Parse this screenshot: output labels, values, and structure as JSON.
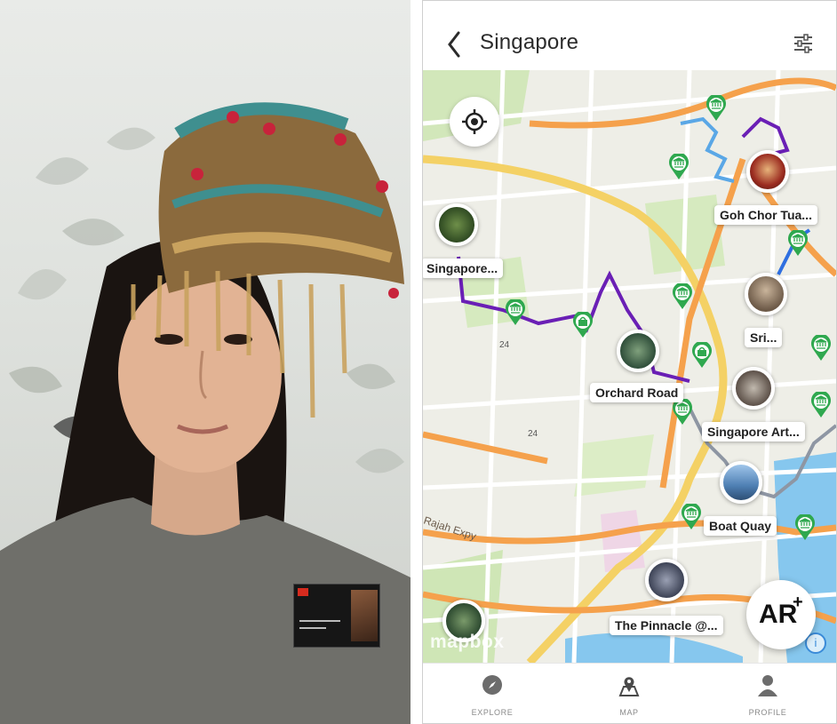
{
  "header": {
    "title": "Singapore",
    "back_icon": "chevron-left-icon",
    "filter_icon": "sliders-icon"
  },
  "map": {
    "pois": [
      {
        "label": "Goh Chor Tua..."
      },
      {
        "label": "Singapore..."
      },
      {
        "label": "Sri..."
      },
      {
        "label": "Orchard Road"
      },
      {
        "label": "Singapore Art..."
      },
      {
        "label": "Boat Quay"
      },
      {
        "label": "The Pinnacle @..."
      }
    ],
    "road_labels": [
      "24",
      "24",
      "Rajah Expy"
    ],
    "attribution": "mapbox",
    "info_label": "i"
  },
  "ar_button": {
    "text": "AR",
    "superscript": "+"
  },
  "nav": [
    {
      "label": "EXPLORE",
      "icon": "compass-icon"
    },
    {
      "label": "MAP",
      "icon": "map-pin-icon"
    },
    {
      "label": "PROFILE",
      "icon": "person-icon"
    }
  ],
  "colors": {
    "pin_green": "#2fa84f",
    "route_purple": "#6a1fb5",
    "road_orange": "#f5a04a",
    "road_yellow": "#f3d265",
    "water": "#7fc3ec",
    "park": "#cfe6b6"
  }
}
